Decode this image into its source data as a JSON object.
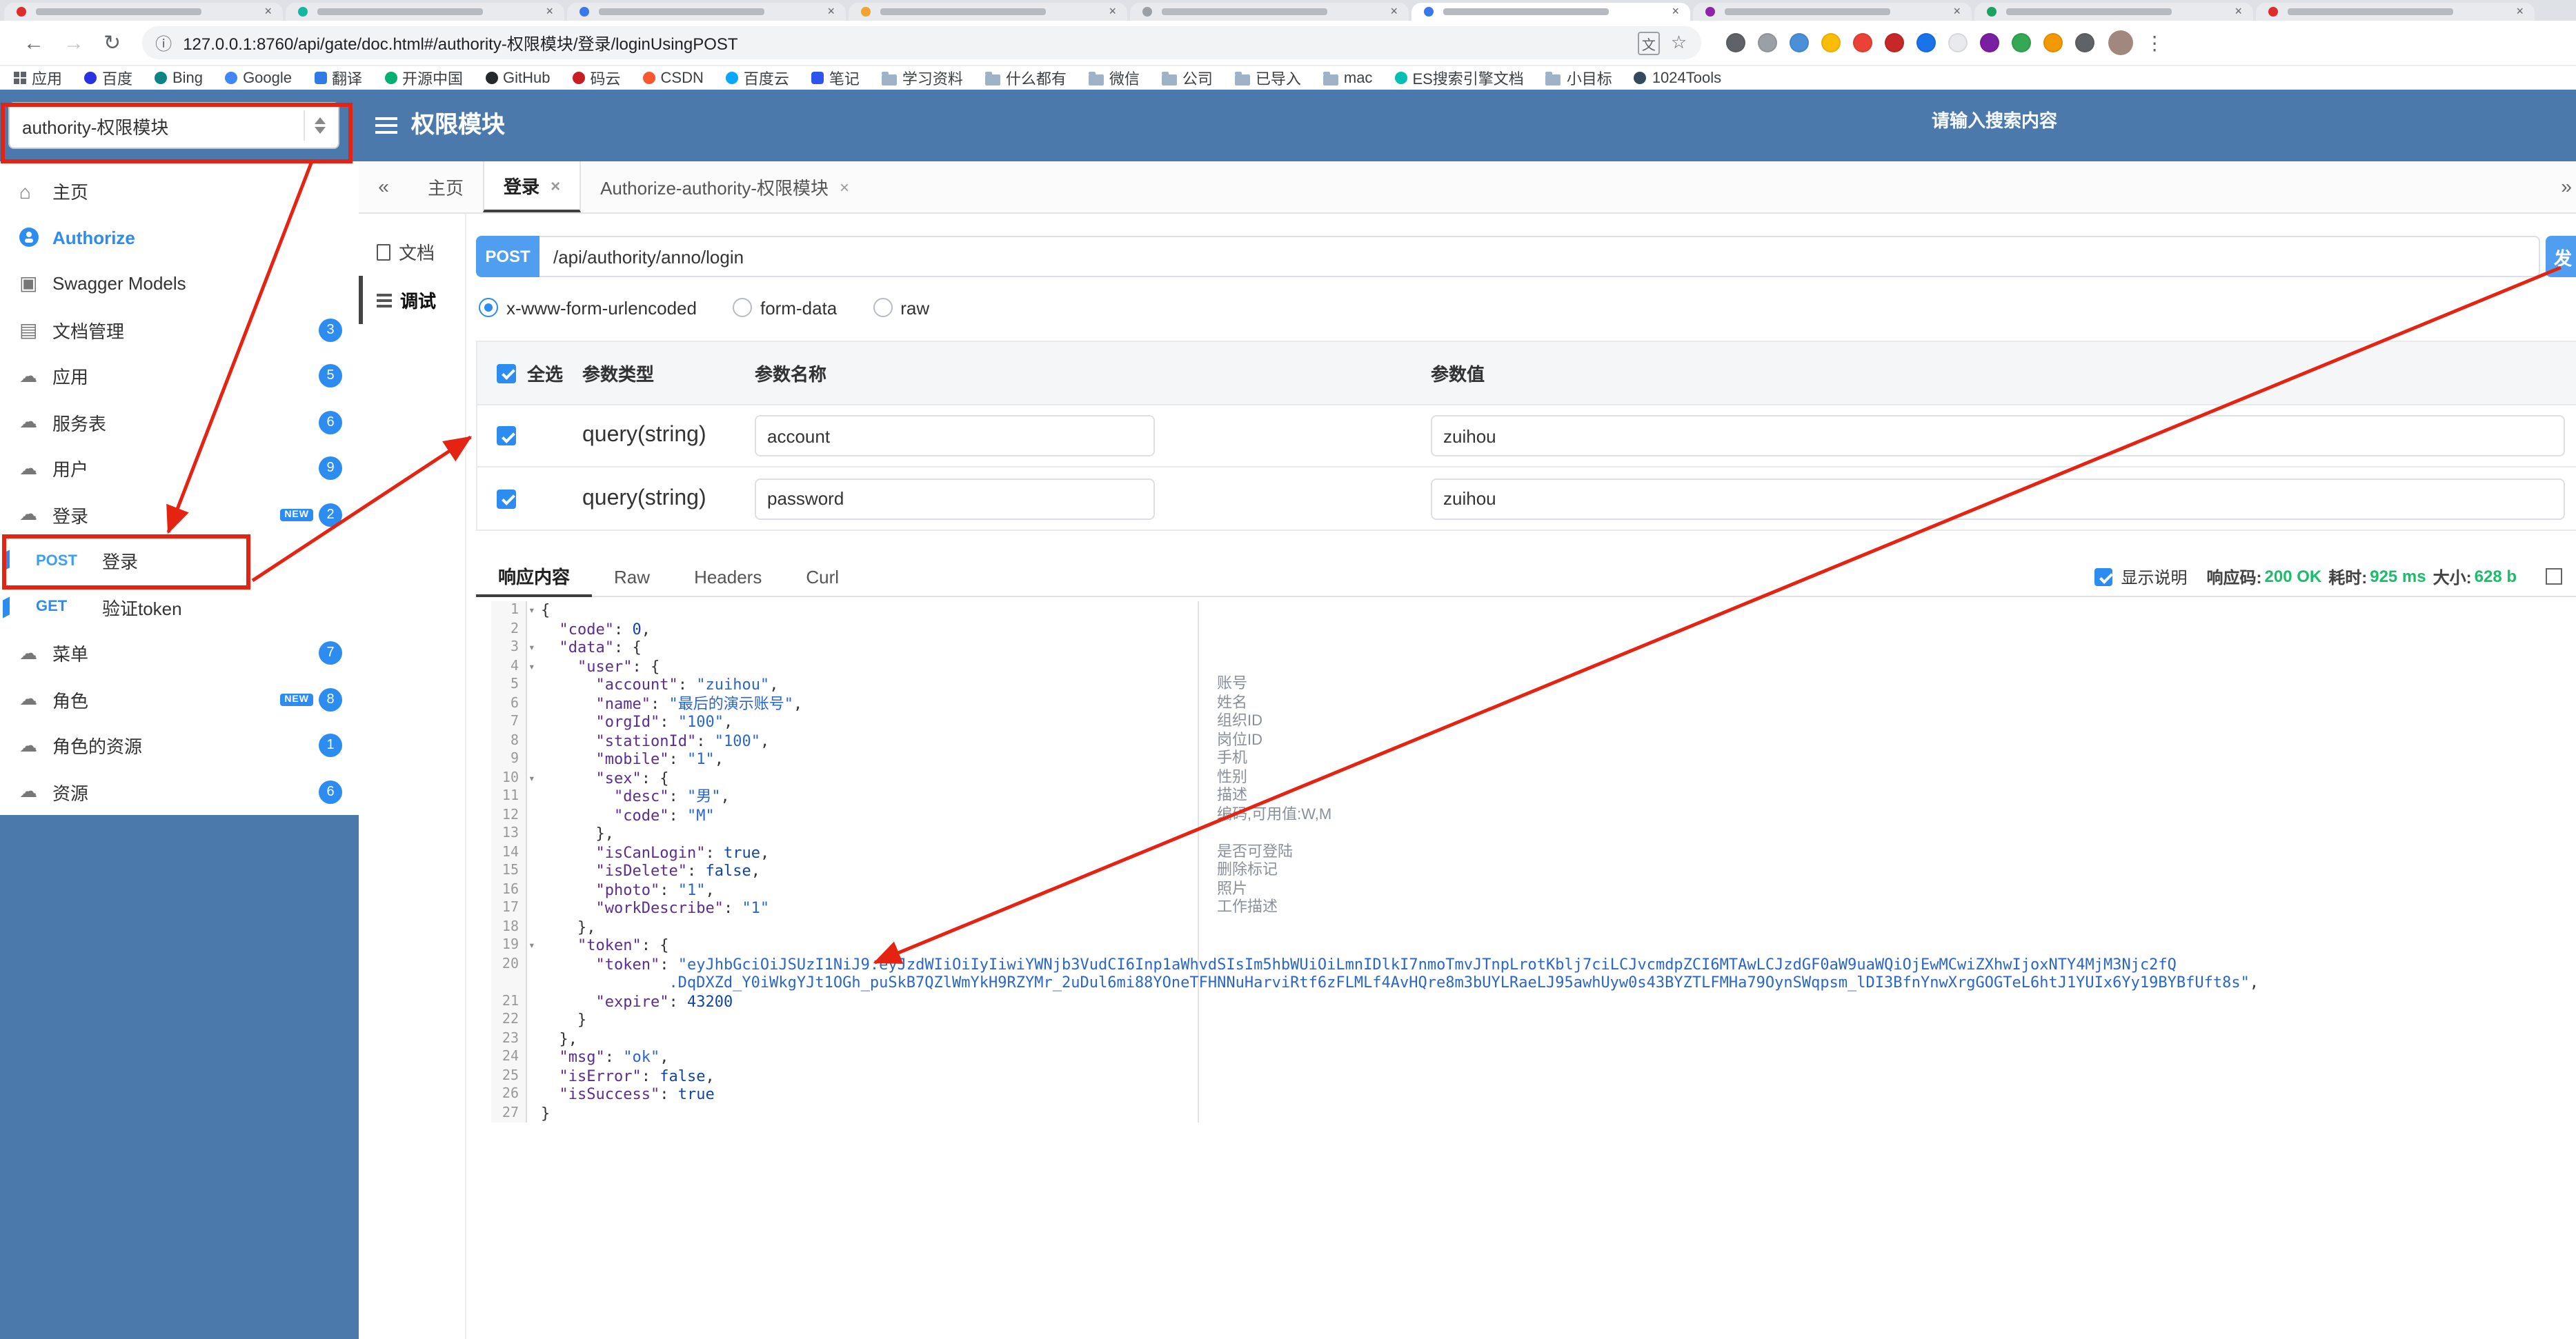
{
  "colors": {
    "header_blue": "#4b79ab",
    "badge_blue": "#2d8cf0",
    "method_blue": "#4f9ef0",
    "annotation_red": "#e42313",
    "success_green": "#19be6b"
  },
  "browser": {
    "tabs": [
      {
        "color": "#e02b2b",
        "label": ""
      },
      {
        "color": "#12b7a0",
        "label": ""
      },
      {
        "color": "#3b78e7",
        "label": ""
      },
      {
        "color": "#f0a32f",
        "label": ""
      },
      {
        "color": "#9aa0a6",
        "label": ""
      },
      {
        "color": "#3b78e7",
        "label": "",
        "active": true
      },
      {
        "color": "#8e24aa",
        "label": ""
      },
      {
        "color": "#1aa260",
        "label": ""
      },
      {
        "color": "#e02b2b",
        "label": ""
      }
    ],
    "toolbar": {
      "url": "127.0.0.1:8760/api/gate/doc.html#/authority-权限模块/登录/loginUsingPOST",
      "extension_colors": [
        "#5f6368",
        "#9aa0a6",
        "#4a90d9",
        "#fbbc05",
        "#ea4335",
        "#c62828",
        "#1a73e8",
        "#e8eaed",
        "#7b1fa2",
        "#34a853",
        "#f29900",
        "#5f6368"
      ]
    },
    "bookmarks": [
      {
        "label": "应用",
        "icon": "grid"
      },
      {
        "label": "百度",
        "icon": "dot",
        "color": "#2932e1"
      },
      {
        "label": "Bing",
        "icon": "dot",
        "color": "#0c8484"
      },
      {
        "label": "Google",
        "icon": "dot",
        "color": "#4285f4"
      },
      {
        "label": "翻译",
        "icon": "square",
        "color": "#2f7ae5"
      },
      {
        "label": "开源中国",
        "icon": "dot",
        "color": "#00b173"
      },
      {
        "label": "GitHub",
        "icon": "dot",
        "color": "#24292e"
      },
      {
        "label": "码云",
        "icon": "dot",
        "color": "#c71d23"
      },
      {
        "label": "CSDN",
        "icon": "dot",
        "color": "#fc5531"
      },
      {
        "label": "百度云",
        "icon": "dot",
        "color": "#06a7ff"
      },
      {
        "label": "笔记",
        "icon": "square",
        "color": "#2f54eb"
      },
      {
        "label": "学习资料",
        "icon": "folder"
      },
      {
        "label": "什么都有",
        "icon": "folder"
      },
      {
        "label": "微信",
        "icon": "folder"
      },
      {
        "label": "公司",
        "icon": "folder"
      },
      {
        "label": "已导入",
        "icon": "folder"
      },
      {
        "label": "mac",
        "icon": "folder"
      },
      {
        "label": "ES搜索引擎文档",
        "icon": "dot",
        "color": "#00bfb3"
      },
      {
        "label": "小目标",
        "icon": "folder"
      },
      {
        "label": "1024Tools",
        "icon": "dot",
        "color": "#34495e"
      }
    ]
  },
  "header": {
    "group_select": "authority-权限模块",
    "title": "权限模块",
    "search_placeholder": "请输入搜索内容"
  },
  "sidebar": {
    "items": [
      {
        "kind": "home",
        "label": "主页"
      },
      {
        "kind": "auth",
        "label": "Authorize"
      },
      {
        "kind": "models",
        "label": "Swagger Models"
      },
      {
        "kind": "docs",
        "label": "文档管理",
        "badge": "3"
      },
      {
        "kind": "group",
        "label": "应用",
        "badge": "5"
      },
      {
        "kind": "group",
        "label": "服务表",
        "badge": "6"
      },
      {
        "kind": "group",
        "label": "用户",
        "badge": "9"
      },
      {
        "kind": "group",
        "label": "登录",
        "badge": "2",
        "new": true
      },
      {
        "kind": "api",
        "method": "POST",
        "label": "登录",
        "marked": true
      },
      {
        "kind": "api",
        "method": "GET",
        "label": "验证token",
        "marked": true
      },
      {
        "kind": "group",
        "label": "菜单",
        "badge": "7"
      },
      {
        "kind": "group",
        "label": "角色",
        "badge": "8",
        "new": true
      },
      {
        "kind": "group",
        "label": "角色的资源",
        "badge": "1"
      },
      {
        "kind": "group",
        "label": "资源",
        "badge": "6"
      }
    ]
  },
  "main": {
    "tabbar": {
      "tabs": [
        {
          "label": "主页",
          "closable": false
        },
        {
          "label": "登录",
          "closable": true,
          "active": true
        },
        {
          "label": "Authorize-authority-权限模块",
          "closable": true
        }
      ]
    },
    "minitabs": [
      {
        "label": "文档"
      },
      {
        "label": "调试",
        "active": true
      }
    ],
    "debug": {
      "method": "POST",
      "url": "/api/authority/anno/login",
      "send_label": "发",
      "body_types": [
        {
          "label": "x-www-form-urlencoded",
          "selected": true
        },
        {
          "label": "form-data"
        },
        {
          "label": "raw"
        }
      ],
      "params": {
        "headers": [
          "全选",
          "参数类型",
          "参数名称",
          "参数值"
        ],
        "rows": [
          {
            "checked": true,
            "type": "query(string)",
            "name": "account",
            "value": "zuihou"
          },
          {
            "checked": true,
            "type": "query(string)",
            "name": "password",
            "value": "zuihou"
          }
        ]
      }
    },
    "response": {
      "tabs": [
        {
          "label": "响应内容",
          "active": true
        },
        {
          "label": "Raw"
        },
        {
          "label": "Headers"
        },
        {
          "label": "Curl"
        }
      ],
      "show_desc_label": "显示说明",
      "meta": [
        {
          "label": "响应码:",
          "value": "200 OK"
        },
        {
          "label": "耗时:",
          "value": "925 ms"
        },
        {
          "label": "大小:",
          "value": "628 b"
        }
      ],
      "code_lines": [
        {
          "ln": "1",
          "fold": true,
          "t": [
            [
              "pu",
              "{"
            ]
          ]
        },
        {
          "ln": "2",
          "t": [
            [
              "pu",
              "  "
            ],
            [
              "ke",
              "\"code\""
            ],
            [
              "pu",
              ": "
            ],
            [
              "li",
              "0"
            ],
            [
              "pu",
              ","
            ]
          ]
        },
        {
          "ln": "3",
          "fold": true,
          "t": [
            [
              "pu",
              "  "
            ],
            [
              "ke",
              "\"data\""
            ],
            [
              "pu",
              ": {"
            ]
          ]
        },
        {
          "ln": "4",
          "fold": true,
          "t": [
            [
              "pu",
              "    "
            ],
            [
              "ke",
              "\"user\""
            ],
            [
              "pu",
              ": {"
            ]
          ]
        },
        {
          "ln": "5",
          "desc": "账号",
          "t": [
            [
              "pu",
              "      "
            ],
            [
              "ke",
              "\"account\""
            ],
            [
              "pu",
              ": "
            ],
            [
              "st",
              "\"zuihou\""
            ],
            [
              "pu",
              ","
            ]
          ]
        },
        {
          "ln": "6",
          "desc": "姓名",
          "t": [
            [
              "pu",
              "      "
            ],
            [
              "ke",
              "\"name\""
            ],
            [
              "pu",
              ": "
            ],
            [
              "st",
              "\"最后的演示账号\""
            ],
            [
              "pu",
              ","
            ]
          ]
        },
        {
          "ln": "7",
          "desc": "组织ID",
          "t": [
            [
              "pu",
              "      "
            ],
            [
              "ke",
              "\"orgId\""
            ],
            [
              "pu",
              ": "
            ],
            [
              "st",
              "\"100\""
            ],
            [
              "pu",
              ","
            ]
          ]
        },
        {
          "ln": "8",
          "desc": "岗位ID",
          "t": [
            [
              "pu",
              "      "
            ],
            [
              "ke",
              "\"stationId\""
            ],
            [
              "pu",
              ": "
            ],
            [
              "st",
              "\"100\""
            ],
            [
              "pu",
              ","
            ]
          ]
        },
        {
          "ln": "9",
          "desc": "手机",
          "t": [
            [
              "pu",
              "      "
            ],
            [
              "ke",
              "\"mobile\""
            ],
            [
              "pu",
              ": "
            ],
            [
              "st",
              "\"1\""
            ],
            [
              "pu",
              ","
            ]
          ]
        },
        {
          "ln": "10",
          "fold": true,
          "desc": "性别",
          "t": [
            [
              "pu",
              "      "
            ],
            [
              "ke",
              "\"sex\""
            ],
            [
              "pu",
              ": {"
            ]
          ]
        },
        {
          "ln": "11",
          "desc": "描述",
          "t": [
            [
              "pu",
              "        "
            ],
            [
              "ke",
              "\"desc\""
            ],
            [
              "pu",
              ": "
            ],
            [
              "st",
              "\"男\""
            ],
            [
              "pu",
              ","
            ]
          ]
        },
        {
          "ln": "12",
          "desc": "编码,可用值:W,M",
          "t": [
            [
              "pu",
              "        "
            ],
            [
              "ke",
              "\"code\""
            ],
            [
              "pu",
              ": "
            ],
            [
              "st",
              "\"M\""
            ]
          ]
        },
        {
          "ln": "13",
          "t": [
            [
              "pu",
              "      },"
            ]
          ]
        },
        {
          "ln": "14",
          "desc": "是否可登陆",
          "t": [
            [
              "pu",
              "      "
            ],
            [
              "ke",
              "\"isCanLogin\""
            ],
            [
              "pu",
              ": "
            ],
            [
              "li",
              "true"
            ],
            [
              "pu",
              ","
            ]
          ]
        },
        {
          "ln": "15",
          "desc": "删除标记",
          "t": [
            [
              "pu",
              "      "
            ],
            [
              "ke",
              "\"isDelete\""
            ],
            [
              "pu",
              ": "
            ],
            [
              "li",
              "false"
            ],
            [
              "pu",
              ","
            ]
          ]
        },
        {
          "ln": "16",
          "desc": "照片",
          "t": [
            [
              "pu",
              "      "
            ],
            [
              "ke",
              "\"photo\""
            ],
            [
              "pu",
              ": "
            ],
            [
              "st",
              "\"1\""
            ],
            [
              "pu",
              ","
            ]
          ]
        },
        {
          "ln": "17",
          "desc": "工作描述",
          "t": [
            [
              "pu",
              "      "
            ],
            [
              "ke",
              "\"workDescribe\""
            ],
            [
              "pu",
              ": "
            ],
            [
              "st",
              "\"1\""
            ]
          ]
        },
        {
          "ln": "18",
          "t": [
            [
              "pu",
              "    },"
            ]
          ]
        },
        {
          "ln": "19",
          "fold": true,
          "t": [
            [
              "pu",
              "    "
            ],
            [
              "ke",
              "\"token\""
            ],
            [
              "pu",
              ": {"
            ]
          ]
        },
        {
          "ln": "20",
          "t": [
            [
              "pu",
              "      "
            ],
            [
              "ke",
              "\"token\""
            ],
            [
              "pu",
              ": "
            ],
            [
              "st",
              "\"eyJhbGciOiJSUzI1NiJ9.eyJzdWIiOiIyIiwiYWNjb3VudCI6Inp1aWhvdSIsIm5hbWUiOiLmnIDlkI7nmoTmvJTnpLrotKblj7ciLCJvcmdpZCI6MTAwLCJzdGF0aW9uaWQiOjEwMCwiZXhwIjoxNTY4MjM3Njc2fQ"
            ]
          ],
          "wrap": [
            [
              "pu",
              "              "
            ],
            [
              "st",
              ".DqDXZd_Y0iWkgYJt1OGh_puSkB7QZlWmYkH9RZYMr_2uDul6mi88YOneTFHNNuHarviRtf6zFLMLf4AvHQre8m3bUYLRaeLJ95awhUyw0s43BYZTLFMHa79OynSWqpsm_lDI3BfnYnwXrgGOGTeL6htJ1YUIx6Yy19BYBfUft8s\""
            ],
            [
              "pu",
              ","
            ]
          ]
        },
        {
          "ln": "21",
          "t": [
            [
              "pu",
              "      "
            ],
            [
              "ke",
              "\"expire\""
            ],
            [
              "pu",
              ": "
            ],
            [
              "li",
              "43200"
            ]
          ]
        },
        {
          "ln": "22",
          "t": [
            [
              "pu",
              "    }"
            ]
          ]
        },
        {
          "ln": "23",
          "t": [
            [
              "pu",
              "  },"
            ]
          ]
        },
        {
          "ln": "24",
          "t": [
            [
              "pu",
              "  "
            ],
            [
              "ke",
              "\"msg\""
            ],
            [
              "pu",
              ": "
            ],
            [
              "st",
              "\"ok\""
            ],
            [
              "pu",
              ","
            ]
          ]
        },
        {
          "ln": "25",
          "t": [
            [
              "pu",
              "  "
            ],
            [
              "ke",
              "\"isError\""
            ],
            [
              "pu",
              ": "
            ],
            [
              "li",
              "false"
            ],
            [
              "pu",
              ","
            ]
          ]
        },
        {
          "ln": "26",
          "t": [
            [
              "pu",
              "  "
            ],
            [
              "ke",
              "\"isSuccess\""
            ],
            [
              "pu",
              ": "
            ],
            [
              "li",
              "true"
            ]
          ]
        },
        {
          "ln": "27",
          "t": [
            [
              "pu",
              "}"
            ]
          ]
        }
      ]
    }
  }
}
